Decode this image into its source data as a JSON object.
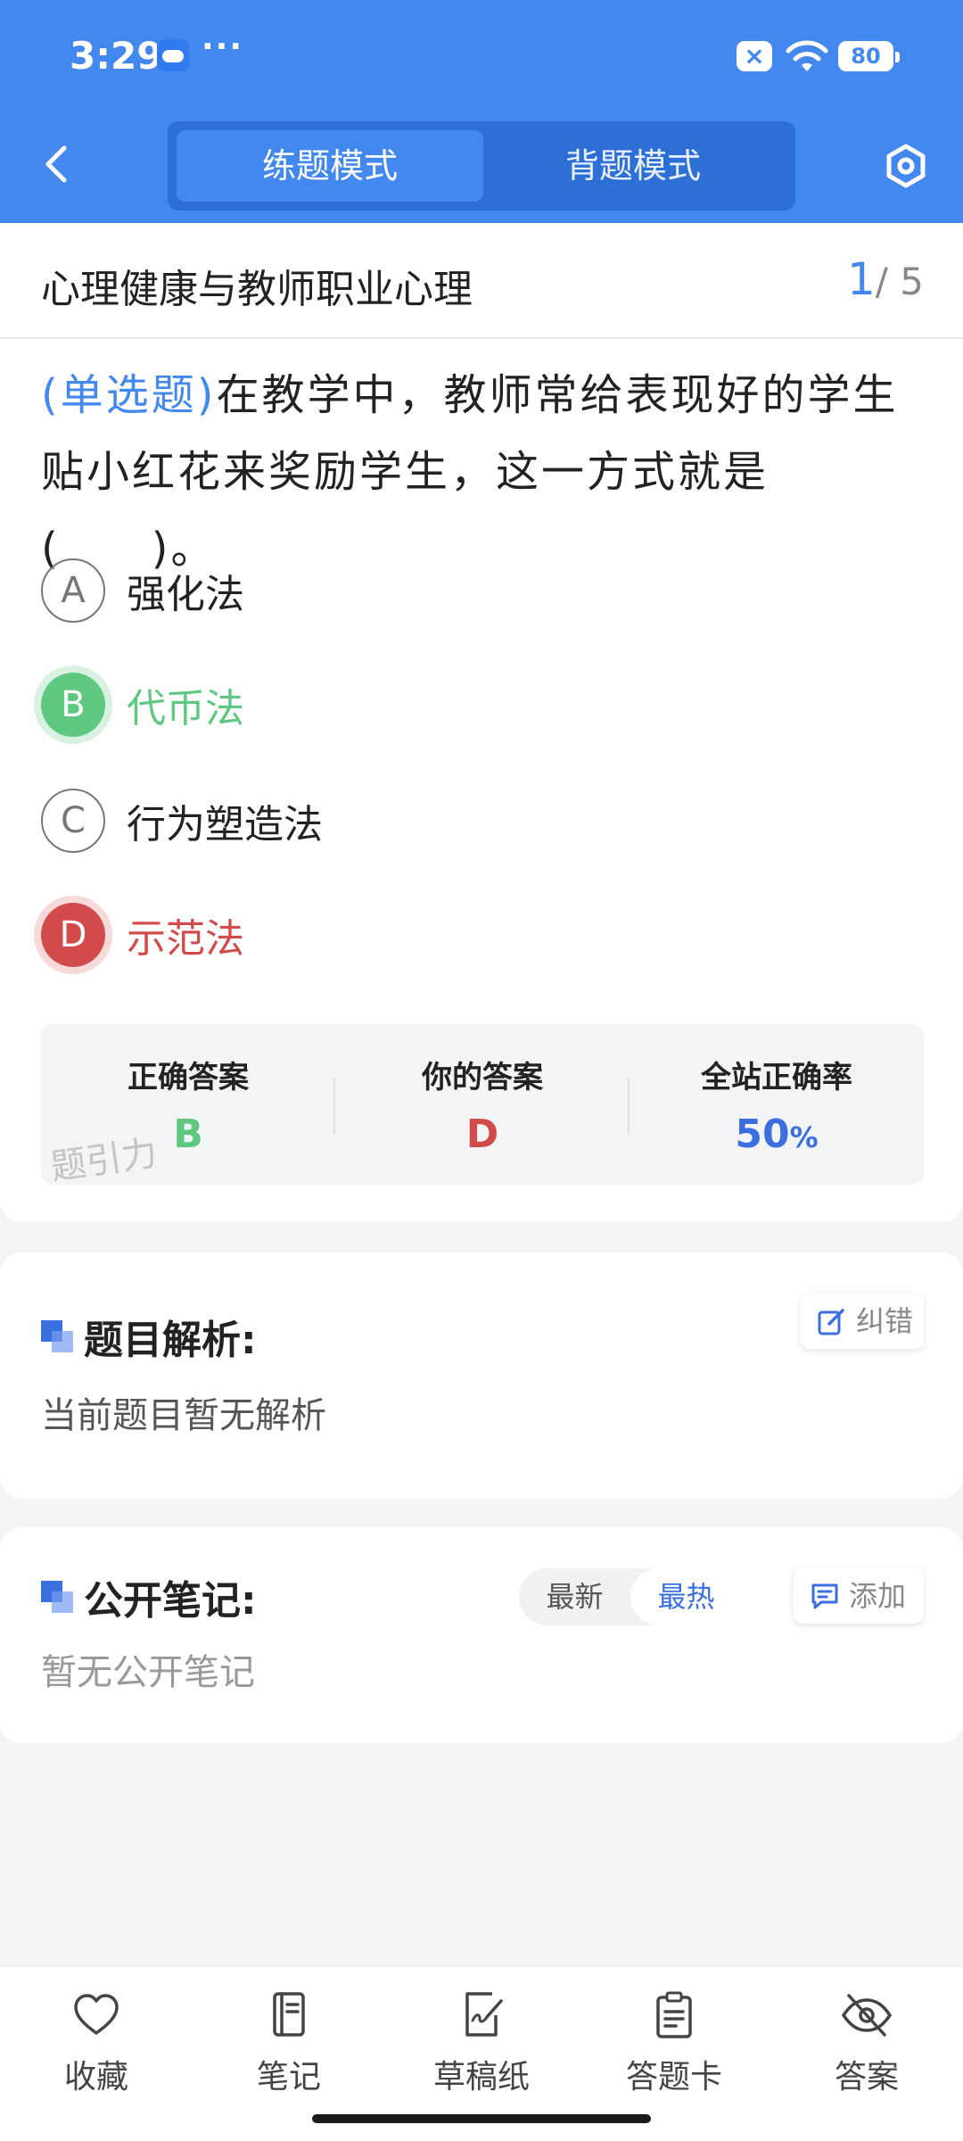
{
  "status_bar": {
    "time": "3:29",
    "dots": "···",
    "battery": "80"
  },
  "header": {
    "tabs": [
      {
        "label": "练题模式",
        "active": true
      },
      {
        "label": "背题模式",
        "active": false
      }
    ]
  },
  "question_card": {
    "subject": "心理健康与教师职业心理",
    "progress": {
      "current": "1",
      "total": "/ 5"
    },
    "question_type": "(单选题)",
    "question_text": "在教学中，教师常给表现好的学生贴小红花来奖励学生，这一方式就是(　　)。",
    "options": [
      {
        "letter": "A",
        "text": "强化法",
        "state": "normal"
      },
      {
        "letter": "B",
        "text": "代币法",
        "state": "correct"
      },
      {
        "letter": "C",
        "text": "行为塑造法",
        "state": "normal"
      },
      {
        "letter": "D",
        "text": "示范法",
        "state": "wrong"
      }
    ],
    "result": {
      "correct_label": "正确答案",
      "correct_value": "B",
      "yours_label": "你的答案",
      "yours_value": "D",
      "rate_label": "全站正确率",
      "rate_value": "50",
      "rate_unit": "%"
    },
    "watermark": "题引力"
  },
  "analysis": {
    "title": "题目解析:",
    "correct_button": "纠错",
    "empty_text": "当前题目暂无解析"
  },
  "notes": {
    "title": "公开笔记:",
    "sort_options": [
      "最新",
      "最热"
    ],
    "active_sort": "最热",
    "add_button": "添加",
    "empty_text": "暂无公开笔记"
  },
  "bottom_nav": [
    {
      "label": "收藏",
      "icon": "heart-icon"
    },
    {
      "label": "笔记",
      "icon": "notebook-icon"
    },
    {
      "label": "草稿纸",
      "icon": "draft-icon"
    },
    {
      "label": "答题卡",
      "icon": "answer-card-icon"
    },
    {
      "label": "答案",
      "icon": "eye-off-icon"
    }
  ],
  "colors": {
    "header_blue": "#4388ee",
    "correct_green": "#5ec780",
    "wrong_red": "#d24b4b",
    "accent_blue": "#3b6fe0"
  }
}
